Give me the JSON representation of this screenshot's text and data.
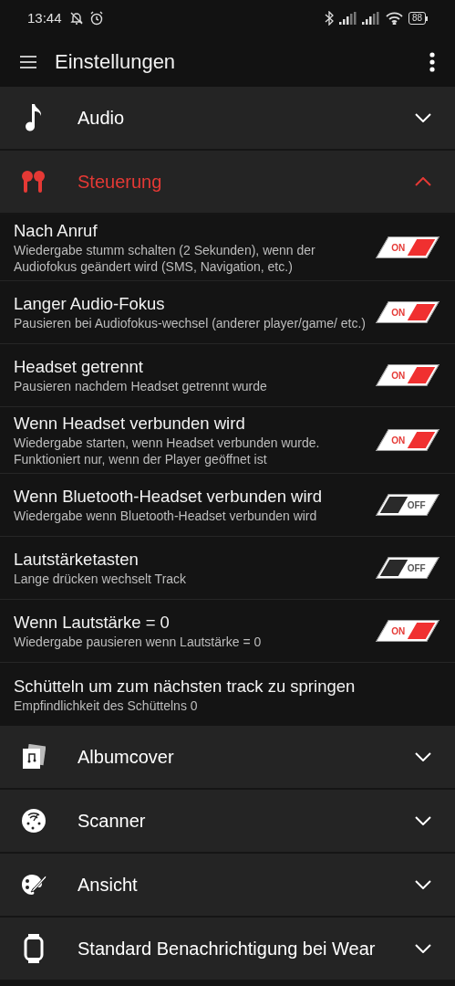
{
  "status_bar": {
    "time": "13:44",
    "battery": "88"
  },
  "app_bar": {
    "title": "Einstellungen"
  },
  "sections_top": [
    {
      "label": "Audio",
      "expanded": false
    },
    {
      "label": "Steuerung",
      "expanded": true
    }
  ],
  "items": [
    {
      "kind": "toggle",
      "title": "Nach Anruf",
      "subtitle": "Wiedergabe stumm schalten (2 Sekunden), wenn der Audiofokus geändert wird (SMS, Navigation, etc.)",
      "on": true,
      "toggle_label": "ON"
    },
    {
      "kind": "toggle",
      "title": "Langer Audio-Fokus",
      "subtitle": "Pausieren bei Audiofokus-wechsel (anderer player/game/ etc.)",
      "on": true,
      "toggle_label": "ON"
    },
    {
      "kind": "toggle",
      "title": "Headset getrennt",
      "subtitle": "Pausieren nachdem Headset getrennt wurde",
      "on": true,
      "toggle_label": "ON"
    },
    {
      "kind": "toggle",
      "title": "Wenn Headset verbunden wird",
      "subtitle": "Wiedergabe starten, wenn Headset verbunden wurde. Funktioniert nur, wenn der Player geöffnet ist",
      "on": true,
      "toggle_label": "ON"
    },
    {
      "kind": "toggle",
      "title": "Wenn Bluetooth-Headset verbunden wird",
      "subtitle": "Wiedergabe wenn Bluetooth-Headset verbunden wird",
      "on": false,
      "toggle_label": "OFF"
    },
    {
      "kind": "toggle",
      "title": "Lautstärketasten",
      "subtitle": "Lange drücken wechselt Track",
      "on": false,
      "toggle_label": "OFF"
    },
    {
      "kind": "toggle",
      "title": "Wenn Lautstärke = 0",
      "subtitle": "Wiedergabe pausieren wenn Lautstärke = 0",
      "on": true,
      "toggle_label": "ON"
    },
    {
      "kind": "text",
      "title": "Schütteln um zum nächsten track zu springen",
      "subtitle": "Empfindlichkeit des Schüttelns 0"
    }
  ],
  "sections_bottom": [
    {
      "label": "Albumcover",
      "expanded": false
    },
    {
      "label": "Scanner",
      "expanded": false
    },
    {
      "label": "Ansicht",
      "expanded": false
    },
    {
      "label": "Standard Benachrichtigung bei Wear",
      "expanded": false
    }
  ]
}
